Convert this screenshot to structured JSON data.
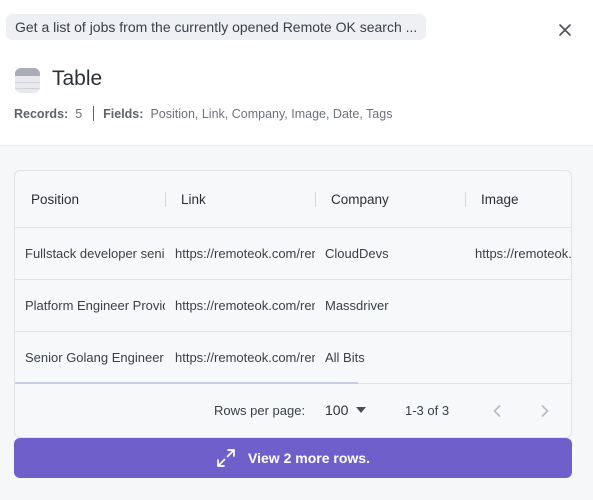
{
  "header": {
    "description": "Get a list of jobs from the currently opened Remote OK search ...",
    "title": "Table",
    "records_label": "Records:",
    "records_value": "5",
    "fields_label": "Fields:",
    "fields_value": "Position, Link, Company, Image, Date, Tags"
  },
  "table": {
    "columns": [
      "Position",
      "Link",
      "Company",
      "Image"
    ],
    "rows": [
      [
        "Fullstack developer senior",
        "https://remoteok.com/remote-jobs",
        "CloudDevs",
        "https://remoteok.com"
      ],
      [
        "Platform Engineer Provider",
        "https://remoteok.com/remote-jobs",
        "Massdriver",
        ""
      ],
      [
        "Senior Golang Engineer",
        "https://remoteok.com/remote-jobs",
        "All Bits",
        ""
      ]
    ]
  },
  "pagination": {
    "rows_per_page_label": "Rows per page:",
    "rows_per_page_value": "100",
    "range": "1-3 of 3"
  },
  "action": {
    "label": "View 2 more rows."
  },
  "colors": {
    "accent": "#6e5fcb"
  }
}
